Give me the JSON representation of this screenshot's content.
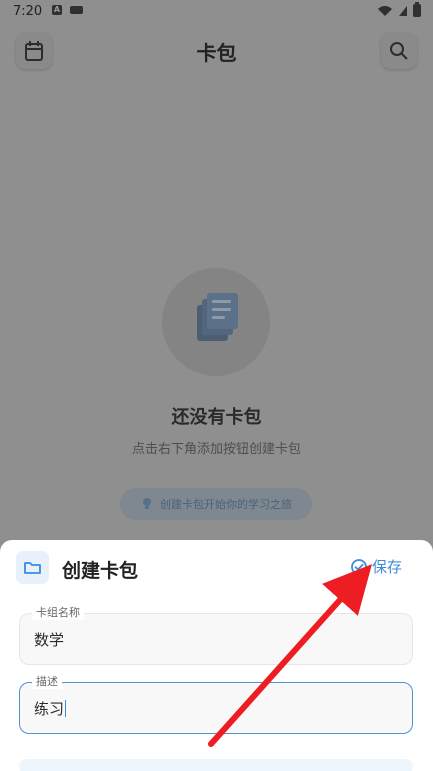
{
  "status_bar": {
    "time": "7:20",
    "left_icons": [
      "a-notification-icon",
      "keyboard-notification-icon"
    ],
    "right_icons": [
      "wifi-icon",
      "signal-icon",
      "battery-icon"
    ]
  },
  "top_bar": {
    "title": "卡包",
    "left_icon": "calendar-icon",
    "right_icon": "search-icon"
  },
  "empty_state": {
    "icon": "stacked-cards-icon",
    "title": "还没有卡包",
    "subtitle": "点击右下角添加按钮创建卡包",
    "tip": "创建卡包开始你的学习之旅",
    "tip_icon": "lightbulb-icon"
  },
  "sheet": {
    "icon": "folder-icon",
    "title": "创建卡包",
    "save_label": "保存",
    "save_icon": "check-circle-icon"
  },
  "form": {
    "name_label": "卡组名称",
    "name_value": "数学",
    "description_label": "描述",
    "description_value": "练习"
  },
  "annotation": {
    "type": "red-arrow",
    "color": "#ee1d24"
  },
  "colors": {
    "accent": "#3d8bd9",
    "overlay": "#8f8f8f",
    "field_background": "#f8f8f8",
    "sheet_background": "#ffffff"
  }
}
